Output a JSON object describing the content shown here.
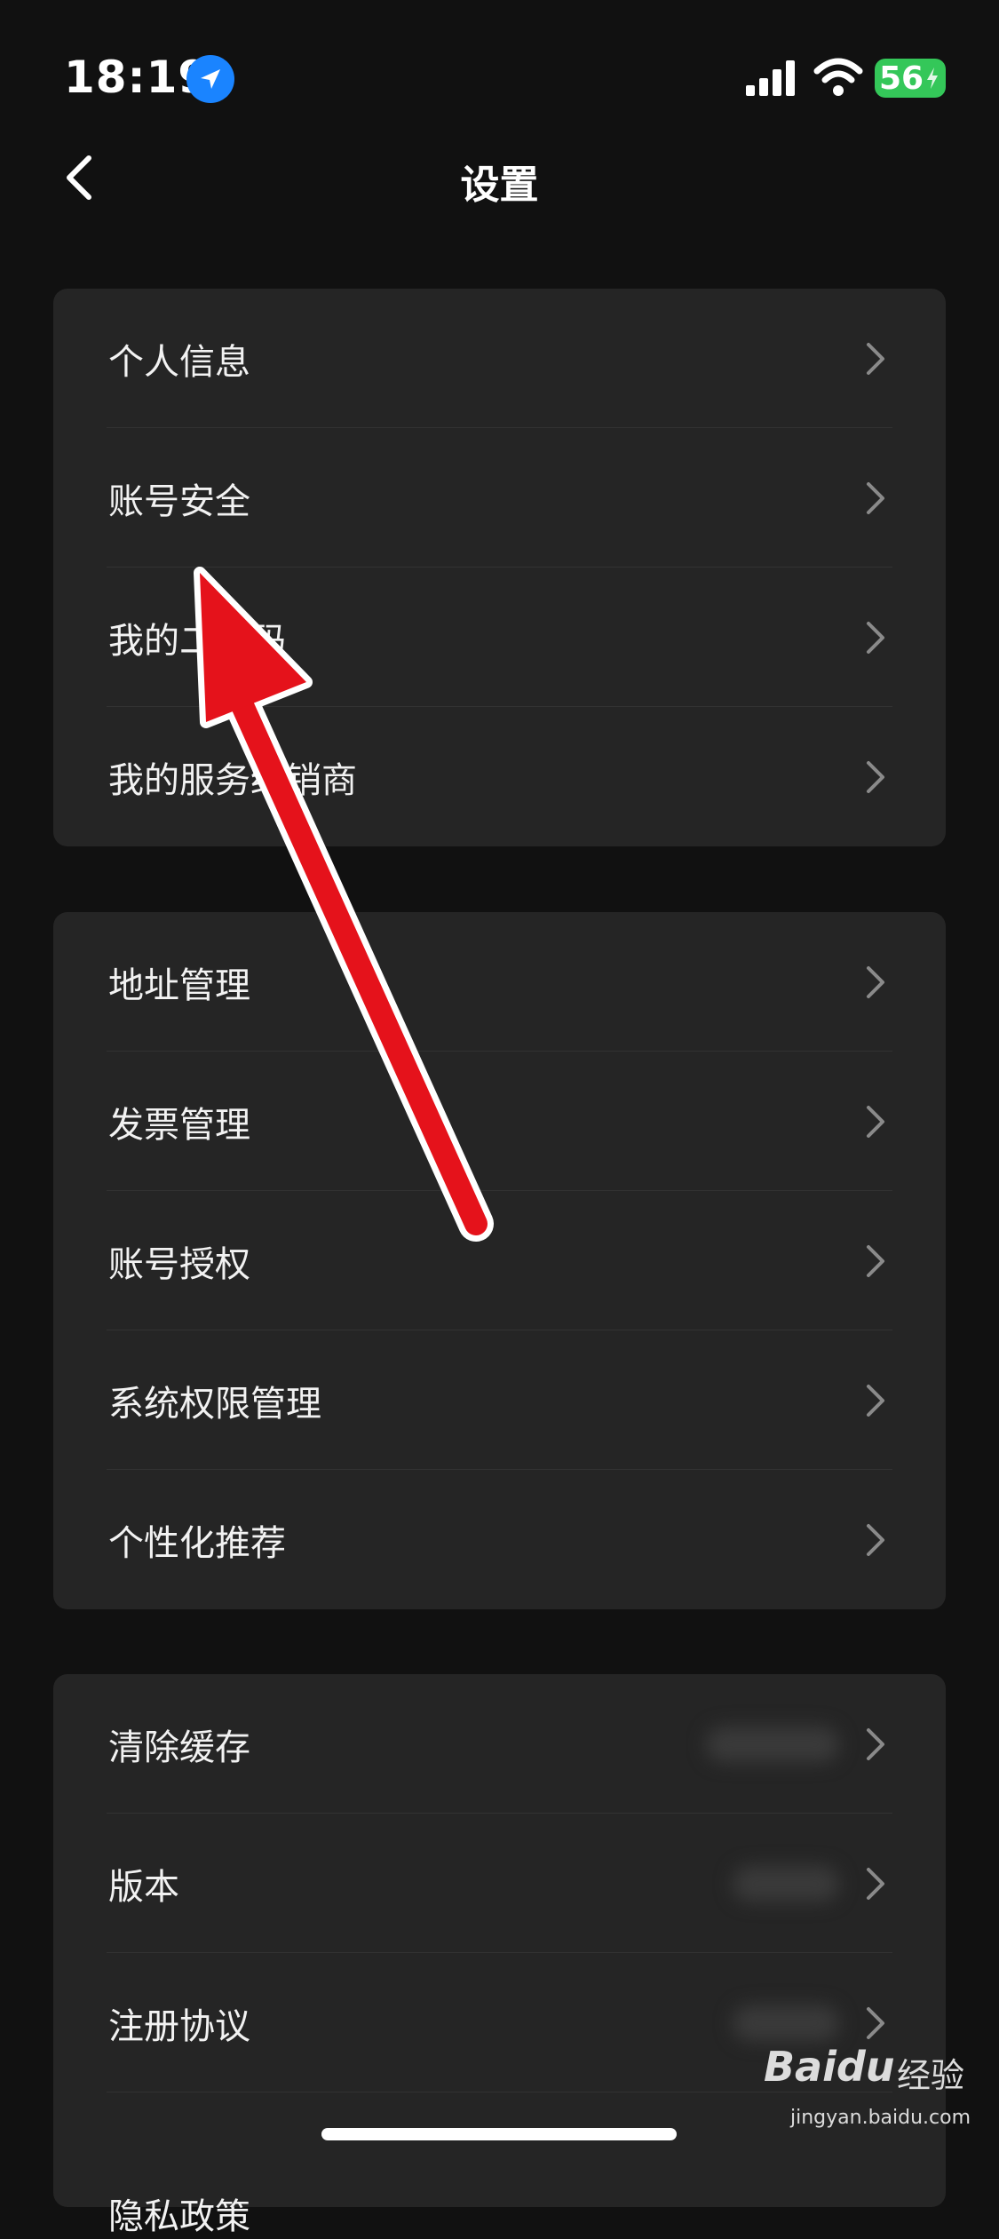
{
  "status_bar": {
    "time": "18:19",
    "battery": "56",
    "icons": [
      "location-icon",
      "signal-icon",
      "wifi-icon",
      "battery-charging-icon"
    ]
  },
  "nav": {
    "title": "设置",
    "back_icon": "chevron-left-icon"
  },
  "groups": [
    {
      "items": [
        {
          "label": "个人信息"
        },
        {
          "label": "账号安全"
        },
        {
          "label": "我的二维码"
        },
        {
          "label": "我的服务经销商"
        }
      ]
    },
    {
      "items": [
        {
          "label": "地址管理"
        },
        {
          "label": "发票管理"
        },
        {
          "label": "账号授权"
        },
        {
          "label": "系统权限管理"
        },
        {
          "label": "个性化推荐"
        }
      ]
    },
    {
      "items": [
        {
          "label": "清除缓存"
        },
        {
          "label": "版本"
        },
        {
          "label": "注册协议"
        },
        {
          "label": "隐私政策"
        }
      ]
    }
  ],
  "watermark": {
    "logo": "Baidu",
    "cn": "经验",
    "url": "jingyan.baidu.com"
  },
  "colors": {
    "background": "#111111",
    "card": "#252525",
    "annotation_arrow": "#e5121b",
    "battery": "#34c759",
    "location": "#1a84ff"
  }
}
